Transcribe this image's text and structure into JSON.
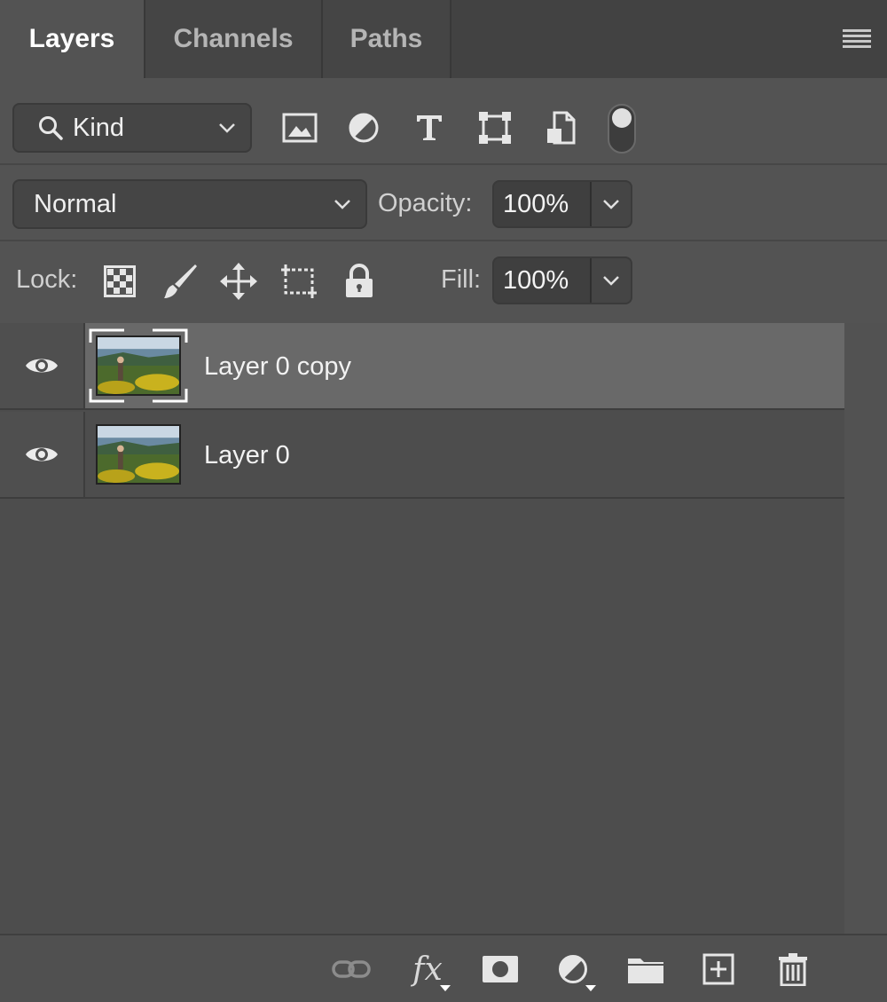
{
  "tabs": [
    {
      "label": "Layers",
      "active": true
    },
    {
      "label": "Channels",
      "active": false
    },
    {
      "label": "Paths",
      "active": false
    }
  ],
  "filter": {
    "kind_label": "Kind",
    "icons": [
      "image-filter-icon",
      "adjustment-filter-icon",
      "type-filter-icon",
      "shape-filter-icon",
      "smart-object-filter-icon"
    ]
  },
  "blend": {
    "mode": "Normal",
    "opacity_label": "Opacity:",
    "opacity_value": "100%"
  },
  "lock": {
    "label": "Lock:",
    "fill_label": "Fill:",
    "fill_value": "100%"
  },
  "layers": [
    {
      "name": "Layer 0 copy",
      "visible": true,
      "selected": true
    },
    {
      "name": "Layer 0",
      "visible": true,
      "selected": false
    }
  ],
  "colors": {
    "panel_bg": "#535353",
    "selected_row": "#696969",
    "text": "#f2f2f2"
  }
}
